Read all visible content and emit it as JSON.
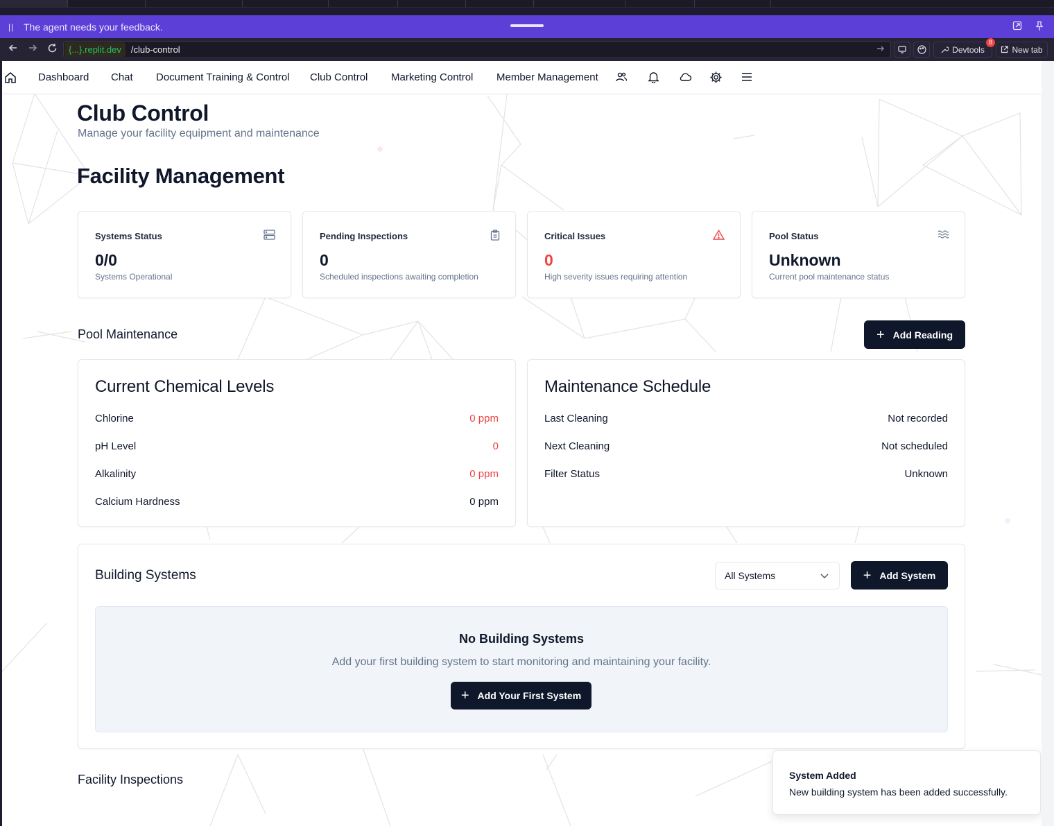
{
  "agent_bar": {
    "message": "The agent needs your feedback."
  },
  "browser": {
    "url_host": "{...}.replit.dev",
    "url_path": "/club-control",
    "devtools_label": "Devtools",
    "devtools_badge": "8",
    "new_tab_label": "New tab"
  },
  "nav": {
    "items": [
      "Dashboard",
      "Chat",
      "Document Training & Control",
      "Club Control",
      "Marketing Control",
      "Member Management"
    ],
    "icons": [
      "home-icon",
      "users-icon",
      "bell-icon",
      "cloud-icon",
      "gear-icon",
      "menu-icon"
    ]
  },
  "header": {
    "title": "Club Control",
    "subtitle": "Manage your facility equipment and maintenance",
    "section": "Facility Management"
  },
  "stats": [
    {
      "label": "Systems Status",
      "value": "0/0",
      "desc": "Systems Operational",
      "icon": "server-icon",
      "color": "#0f172a"
    },
    {
      "label": "Pending Inspections",
      "value": "0",
      "desc": "Scheduled inspections awaiting completion",
      "icon": "clipboard-icon",
      "color": "#0f172a"
    },
    {
      "label": "Critical Issues",
      "value": "0",
      "desc": "High severity issues requiring attention",
      "icon": "alert-triangle-icon",
      "color": "#ef4444"
    },
    {
      "label": "Pool Status",
      "value": "Unknown",
      "desc": "Current pool maintenance status",
      "icon": "waves-icon",
      "color": "#0f172a"
    }
  ],
  "pool": {
    "heading": "Pool Maintenance",
    "add_reading_label": "Add Reading",
    "chemical": {
      "title": "Current Chemical Levels",
      "rows": [
        {
          "label": "Chlorine",
          "value": "0 ppm"
        },
        {
          "label": "pH Level",
          "value": "0"
        },
        {
          "label": "Alkalinity",
          "value": "0 ppm"
        },
        {
          "label": "Calcium Hardness",
          "value": "0 ppm"
        }
      ]
    },
    "schedule": {
      "title": "Maintenance Schedule",
      "rows": [
        {
          "label": "Last Cleaning",
          "value": "Not recorded"
        },
        {
          "label": "Next Cleaning",
          "value": "Not scheduled"
        },
        {
          "label": "Filter Status",
          "value": "Unknown"
        }
      ]
    }
  },
  "building": {
    "title": "Building Systems",
    "filter_selected": "All Systems",
    "add_label": "Add System",
    "empty_title": "No Building Systems",
    "empty_desc": "Add your first building system to start monitoring and maintaining your facility.",
    "empty_button": "Add Your First System"
  },
  "inspections": {
    "heading": "Facility Inspections"
  },
  "toast": {
    "title": "System Added",
    "desc": "New building system has been added successfully."
  },
  "colors": {
    "accent": "#5b3fd6",
    "dark": "#0f172a",
    "danger": "#ef4444",
    "muted": "#64748b"
  }
}
